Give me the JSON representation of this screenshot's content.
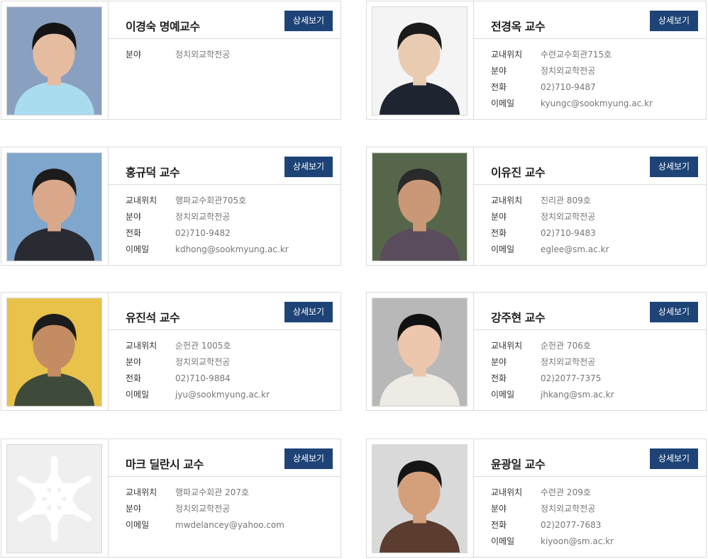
{
  "profiles": [
    {
      "name": "이경숙 명예교수",
      "button": "상세보기",
      "bg": "#8aa0c0",
      "suit": "#a9dcef",
      "hair": "#141414",
      "skin": "#e6bca0",
      "fields": [
        {
          "label": "분야",
          "value": "정치외교학전공"
        }
      ]
    },
    {
      "name": "전경옥 교수",
      "button": "상세보기",
      "bg": "#f4f4f4",
      "suit": "#1e2430",
      "hair": "#1a1a1a",
      "skin": "#e9cbb2",
      "fields": [
        {
          "label": "교내위치",
          "value": "수련교수회관715호"
        },
        {
          "label": "분야",
          "value": "정치외교학전공"
        },
        {
          "label": "전화",
          "value": "02)710-9487"
        },
        {
          "label": "이메일",
          "value": "kyungc@sookmyung.ac.kr"
        }
      ]
    },
    {
      "name": "홍규덕 교수",
      "button": "상세보기",
      "bg": "#7fa6cd",
      "suit": "#2a2a33",
      "hair": "#1c1c1c",
      "skin": "#d9a88a",
      "fields": [
        {
          "label": "교내위치",
          "value": "행파교수회관705호"
        },
        {
          "label": "분야",
          "value": "정치외교학전공"
        },
        {
          "label": "전화",
          "value": "02)710-9482"
        },
        {
          "label": "이메일",
          "value": "kdhong@sookmyung.ac.kr"
        }
      ]
    },
    {
      "name": "이유진 교수",
      "button": "상세보기",
      "bg": "#56664a",
      "suit": "#5a4c5c",
      "hair": "#2a2a2a",
      "skin": "#c99877",
      "fields": [
        {
          "label": "교내위치",
          "value": "진리관 809호"
        },
        {
          "label": "분야",
          "value": "정치외교학전공"
        },
        {
          "label": "전화",
          "value": "02)710-9483"
        },
        {
          "label": "이메일",
          "value": "eglee@sm.ac.kr"
        }
      ]
    },
    {
      "name": "유진석 교수",
      "button": "상세보기",
      "bg": "#e8c24a",
      "suit": "#3e4a3a",
      "hair": "#1b1b1b",
      "skin": "#c48c62",
      "fields": [
        {
          "label": "교내위치",
          "value": "순헌관 1005호"
        },
        {
          "label": "분야",
          "value": "정치외교학전공"
        },
        {
          "label": "전화",
          "value": "02)710-9884"
        },
        {
          "label": "이메일",
          "value": "jyu@sookmyung.ac.kr"
        }
      ]
    },
    {
      "name": "강주현 교수",
      "button": "상세보기",
      "bg": "#b8b8b8",
      "suit": "#eeeae4",
      "hair": "#111111",
      "skin": "#ecc7ad",
      "fields": [
        {
          "label": "교내위치",
          "value": "순헌관 706호"
        },
        {
          "label": "분야",
          "value": "정치외교학전공"
        },
        {
          "label": "전화",
          "value": "02)2077-7375"
        },
        {
          "label": "이메일",
          "value": "jhkang@sm.ac.kr"
        }
      ]
    },
    {
      "name": "마크 딜란시 교수",
      "button": "상세보기",
      "placeholder": true,
      "fields": [
        {
          "label": "교내위치",
          "value": "행파교수회관 207호"
        },
        {
          "label": "분야",
          "value": "정치외교학전공"
        },
        {
          "label": "이메일",
          "value": "mwdelancey@yahoo.com"
        }
      ]
    },
    {
      "name": "윤광일 교수",
      "button": "상세보기",
      "bg": "#d9d9d9",
      "suit": "#5a3d2e",
      "hair": "#151515",
      "skin": "#d4a07c",
      "fields": [
        {
          "label": "교내위치",
          "value": "수련관 209호"
        },
        {
          "label": "분야",
          "value": "정치외교학전공"
        },
        {
          "label": "전화",
          "value": "02)2077-7683"
        },
        {
          "label": "이메일",
          "value": "kiyoon@sm.ac.kr"
        }
      ]
    }
  ]
}
